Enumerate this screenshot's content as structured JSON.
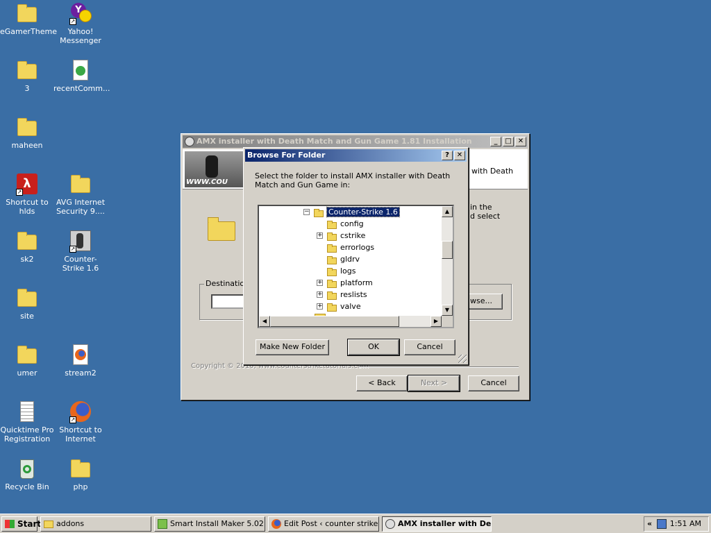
{
  "desktop": {
    "icons": [
      {
        "label": "eGamerTheme",
        "icon": "folder-icon"
      },
      {
        "label": "Yahoo! Messenger",
        "icon": "yahoo-messenger-icon"
      },
      {
        "label": "3",
        "icon": "folder-icon"
      },
      {
        "label": "recentComm...",
        "icon": "media-file-icon"
      },
      {
        "label": "maheen",
        "icon": "folder-icon"
      },
      {
        "label": "Shortcut to hlds",
        "icon": "half-life-icon"
      },
      {
        "label": "AVG Internet Security 9....",
        "icon": "folder-icon"
      },
      {
        "label": "sk2",
        "icon": "folder-icon"
      },
      {
        "label": "Counter-Strike 1.6",
        "icon": "counter-strike-icon"
      },
      {
        "label": "site",
        "icon": "folder-icon"
      },
      {
        "label": "umer",
        "icon": "folder-icon"
      },
      {
        "label": "stream2",
        "icon": "firefox-file-icon"
      },
      {
        "label": "Quicktime Pro Registration",
        "icon": "text-document-icon"
      },
      {
        "label": "Shortcut to Internet",
        "icon": "firefox-icon"
      },
      {
        "label": "Recycle Bin",
        "icon": "recycle-bin-icon"
      },
      {
        "label": "php",
        "icon": "folder-icon"
      }
    ]
  },
  "installer": {
    "title": "AMX installer with Death Match and Gun Game 1.81 Installation",
    "header_text": "with Death",
    "body_text_1": "in the",
    "body_text_2": "d select",
    "destination_label": "Destination",
    "browse_label": "wse...",
    "copyright": "Copyright © 2010, www.counterstriketutorials.com",
    "back_label": "< Back",
    "next_label": "Next >",
    "cancel_label": "Cancel",
    "banner_text": "WWW.COU"
  },
  "dialog": {
    "title": "Browse For Folder",
    "help": "?",
    "close": "✕",
    "message": "Select the folder to install AMX installer with Death Match and Gun Game in:",
    "tree": {
      "root": "Counter-Strike 1.6",
      "children": [
        "config",
        "cstrike",
        "errorlogs",
        "gldrv",
        "logs",
        "platform",
        "reslists",
        "valve"
      ]
    },
    "new_folder_label": "Make New Folder",
    "ok_label": "OK",
    "cancel_label": "Cancel"
  },
  "taskbar": {
    "start_label": "Start",
    "tasks": [
      "addons",
      "Smart Install Maker 5.02 ...",
      "Edit Post ‹ counter strike...",
      "AMX installer with De..."
    ],
    "tray_chevron": "«",
    "clock": "1:51 AM"
  }
}
